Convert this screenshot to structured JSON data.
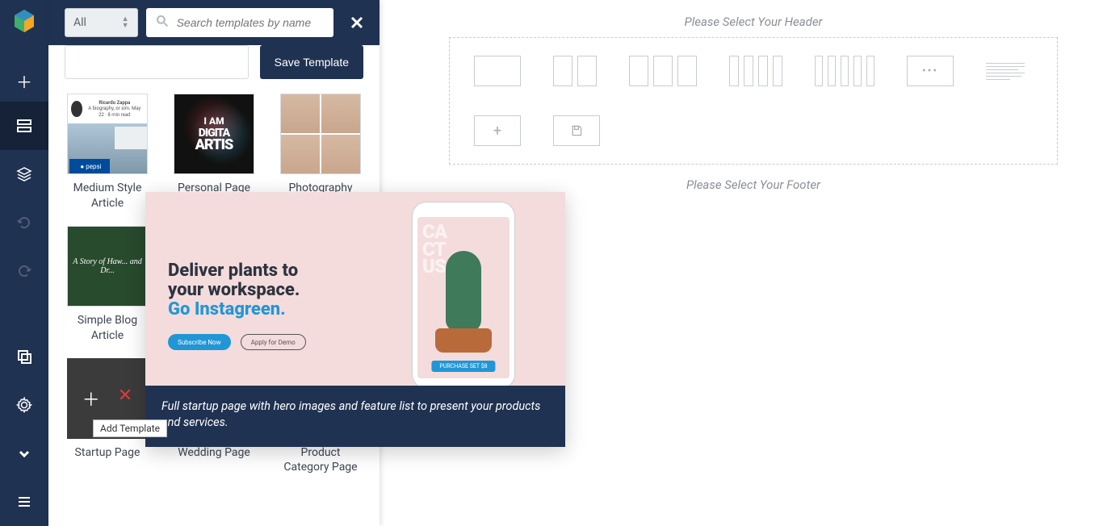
{
  "sidebar": {
    "items": [
      "add",
      "row",
      "layers",
      "undo",
      "redo",
      "fullscreen",
      "settings",
      "expand",
      "menu"
    ]
  },
  "panel": {
    "filter_label": "All",
    "search_placeholder": "Search templates by name",
    "save_button": "Save Template",
    "tooltip": "Add Template",
    "templates": [
      {
        "label": "Medium Style Article"
      },
      {
        "label": "Personal Page"
      },
      {
        "label": "Photography"
      },
      {
        "label": "Simple Blog Article"
      },
      {
        "label": "Startup Page"
      },
      {
        "label": "Wedding Page"
      },
      {
        "label": "Product Category Page"
      }
    ],
    "thumb_text": {
      "medium_author": "Ricardo Zappa",
      "medium_sub": "A biography, or sim.\nMay 22 · 8 min read",
      "medium_pepsi": "pepsi",
      "personal_l1": "I AM",
      "personal_l2": "DIGITA",
      "personal_l3": "ARTIS",
      "simple": "A Story of Haw... and Dr..."
    }
  },
  "flyout": {
    "line1": "Deliver plants to",
    "line2": "your workspace.",
    "line3": "Go Instagreen.",
    "btn1": "Subscribe Now",
    "btn2": "Apply for Demo",
    "phone_cta": "PURCHASE SET $8",
    "phone_bigtext": "CA\nCT\nUS",
    "description": "Full startup page with hero images and feature list to present your products and services."
  },
  "canvas": {
    "header_hint": "Please Select Your Header",
    "footer_hint": "Please Select Your Footer"
  }
}
